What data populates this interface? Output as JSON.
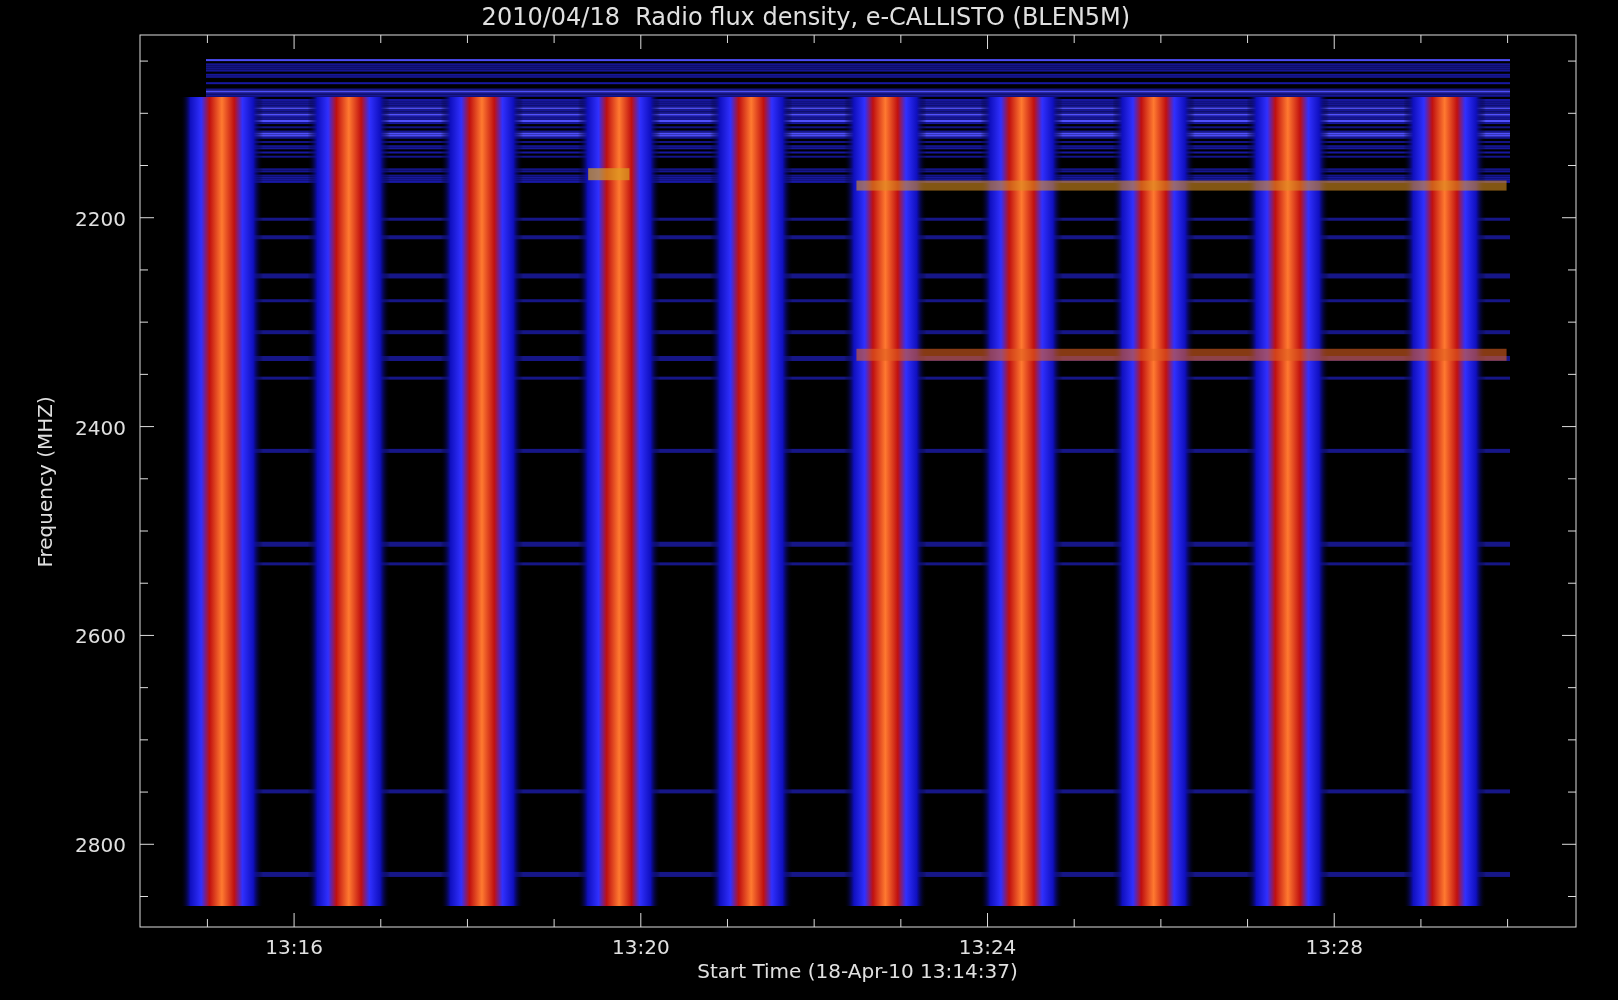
{
  "plot": {
    "title": "2010/04/18  Radio flux density, e-CALLISTO (BLEN5M)",
    "ylabel": "Frequency (MHZ)",
    "xlabel": "Start Time (18-Apr-10 13:14:37)",
    "yticks": [
      "2200",
      "2400",
      "2600",
      "2800"
    ],
    "xticks": [
      "13:16",
      "13:20",
      "13:24",
      "13:28"
    ]
  }
}
